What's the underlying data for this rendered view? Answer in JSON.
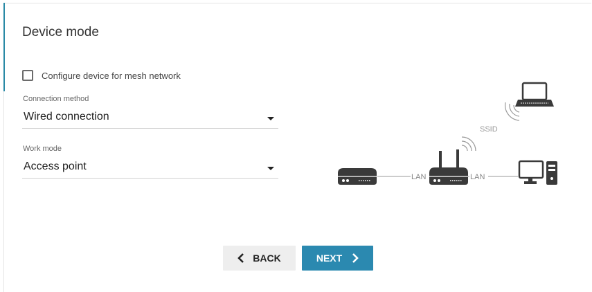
{
  "page": {
    "title": "Device mode"
  },
  "mesh_checkbox": {
    "label": "Configure device for mesh network",
    "checked": false
  },
  "connection_method": {
    "label": "Connection method",
    "value": "Wired connection"
  },
  "work_mode": {
    "label": "Work mode",
    "value": "Access point"
  },
  "diagram": {
    "ssid_label": "SSID",
    "lan_label_left": "LAN",
    "lan_label_right": "LAN",
    "icons": [
      "laptop-icon",
      "wifi-signal-icon",
      "modem-icon",
      "router-icon",
      "desktop-computer-icon"
    ]
  },
  "buttons": {
    "back": "BACK",
    "next": "NEXT"
  },
  "colors": {
    "accent": "#2b89b0",
    "back_bg": "#eeeeee",
    "icon": "#3a3a3a"
  }
}
